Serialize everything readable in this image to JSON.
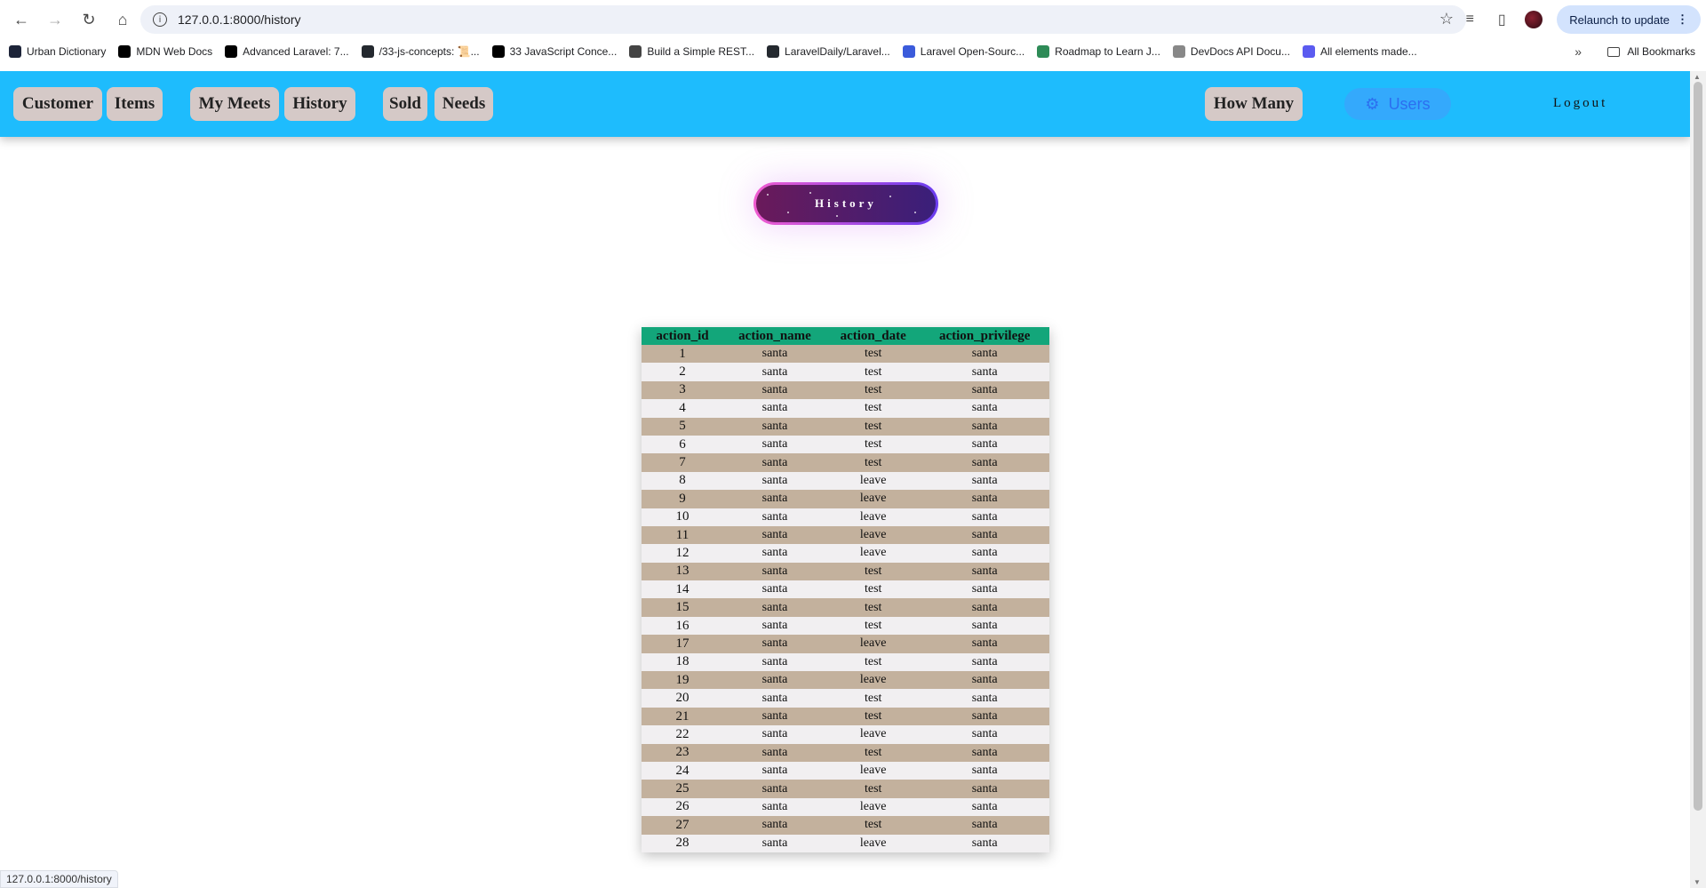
{
  "browser": {
    "url": "127.0.0.1:8000/history",
    "relaunch_label": "Relaunch to update",
    "bookmarks": [
      {
        "label": "Urban Dictionary",
        "icon": "urban-dictionary-icon",
        "color": "#1d2439"
      },
      {
        "label": "MDN Web Docs",
        "icon": "mdn-icon",
        "color": "#000000"
      },
      {
        "label": "Advanced Laravel: 7...",
        "icon": "medium-icon",
        "color": "#000000"
      },
      {
        "label": "/33-js-concepts: 📜...",
        "icon": "github-icon",
        "color": "#24292f"
      },
      {
        "label": "33 JavaScript Conce...",
        "icon": "dev-icon",
        "color": "#000000"
      },
      {
        "label": "Build a Simple REST...",
        "icon": "code-icon",
        "color": "#444444"
      },
      {
        "label": "LaravelDaily/Laravel...",
        "icon": "github-icon",
        "color": "#24292f"
      },
      {
        "label": "Laravel Open-Sourc...",
        "icon": "laravel-icon",
        "color": "#3b5bdb"
      },
      {
        "label": "Roadmap to Learn J...",
        "icon": "roadmap-icon",
        "color": "#2e8b57"
      },
      {
        "label": "DevDocs API Docu...",
        "icon": "devdocs-icon",
        "color": "#888888"
      },
      {
        "label": "All elements made...",
        "icon": "uiverse-icon",
        "color": "#5b5bf0"
      }
    ],
    "all_bookmarks_label": "All Bookmarks",
    "status_url": "127.0.0.1:8000/history"
  },
  "navbar": {
    "customer": "Customer",
    "items": "Items",
    "my_meets": "My Meets",
    "history": "History",
    "sold": "Sold",
    "needs": "Needs",
    "how_many": "How Many",
    "users": "Users",
    "logout": "Logout"
  },
  "heading": "History",
  "colors": {
    "navbar": "#1ebcfd",
    "table_header": "#13a67a",
    "row_odd": "#c3b19d",
    "row_even": "#f1eff1"
  },
  "table": {
    "headers": [
      "action_id",
      "action_name",
      "action_date",
      "action_privilege"
    ],
    "rows": [
      [
        "1",
        "santa",
        "test",
        "santa"
      ],
      [
        "2",
        "santa",
        "test",
        "santa"
      ],
      [
        "3",
        "santa",
        "test",
        "santa"
      ],
      [
        "4",
        "santa",
        "test",
        "santa"
      ],
      [
        "5",
        "santa",
        "test",
        "santa"
      ],
      [
        "6",
        "santa",
        "test",
        "santa"
      ],
      [
        "7",
        "santa",
        "test",
        "santa"
      ],
      [
        "8",
        "santa",
        "leave",
        "santa"
      ],
      [
        "9",
        "santa",
        "leave",
        "santa"
      ],
      [
        "10",
        "santa",
        "leave",
        "santa"
      ],
      [
        "11",
        "santa",
        "leave",
        "santa"
      ],
      [
        "12",
        "santa",
        "leave",
        "santa"
      ],
      [
        "13",
        "santa",
        "test",
        "santa"
      ],
      [
        "14",
        "santa",
        "test",
        "santa"
      ],
      [
        "15",
        "santa",
        "test",
        "santa"
      ],
      [
        "16",
        "santa",
        "test",
        "santa"
      ],
      [
        "17",
        "santa",
        "leave",
        "santa"
      ],
      [
        "18",
        "santa",
        "test",
        "santa"
      ],
      [
        "19",
        "santa",
        "leave",
        "santa"
      ],
      [
        "20",
        "santa",
        "test",
        "santa"
      ],
      [
        "21",
        "santa",
        "test",
        "santa"
      ],
      [
        "22",
        "santa",
        "leave",
        "santa"
      ],
      [
        "23",
        "santa",
        "test",
        "santa"
      ],
      [
        "24",
        "santa",
        "leave",
        "santa"
      ],
      [
        "25",
        "santa",
        "test",
        "santa"
      ],
      [
        "26",
        "santa",
        "leave",
        "santa"
      ],
      [
        "27",
        "santa",
        "test",
        "santa"
      ],
      [
        "28",
        "santa",
        "leave",
        "santa"
      ]
    ]
  }
}
